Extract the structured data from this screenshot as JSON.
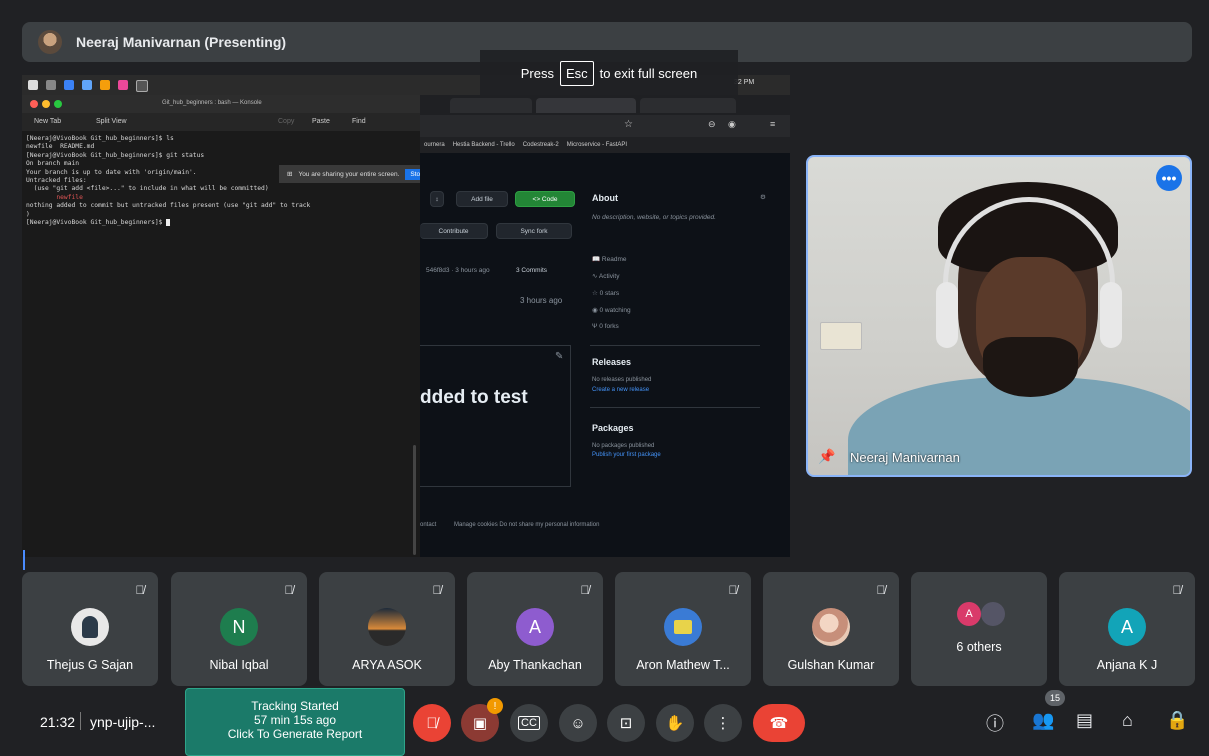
{
  "presenter_bar": {
    "title": "Neeraj Manivarnan (Presenting)"
  },
  "fullscreen_hint": {
    "before": "Press",
    "key": "Esc",
    "after": "to exit full screen"
  },
  "mac": {
    "clock": "32 PM"
  },
  "terminal": {
    "title": "Git_hub_beginners : bash — Konsole",
    "toolbar": {
      "new_tab": "New Tab",
      "split_view": "Split View",
      "copy": "Copy",
      "paste": "Paste",
      "find": "Find"
    },
    "lines": [
      "[Neeraj@VivoBook Git_hub_beginners]$ ls",
      "newfile  README.md",
      "[Neeraj@VivoBook Git_hub_beginners]$ git status",
      "On branch main",
      "Your branch is up to date with 'origin/main'.",
      "",
      "Untracked files:",
      "  (use \"git add <file>...\" to include in what will be committed)"
    ],
    "untracked_file": "        newfile",
    "lines_after": [
      "",
      "nothing added to commit but untracked files present (use \"git add\" to track",
      ")",
      "[Neeraj@VivoBook Git_hub_beginners]$ "
    ]
  },
  "share_notice": {
    "text": "You are sharing your entire screen.",
    "stop": "Stop Sharing"
  },
  "browser": {
    "bookmarks": [
      "Hestia Backend - Trello",
      "Codestreak-2",
      "Microservice - FastAPI"
    ],
    "bookmark_folder": "ournera",
    "add_file": "Add file",
    "code": "<> Code",
    "contribute": "Contribute",
    "sync_fork": "Sync fork",
    "commit_meta": "546f8d3 · 3 hours ago",
    "commits": "3 Commits",
    "ago": "3 hours ago",
    "big_text": "dded to test",
    "footer": "Manage cookies   Do not share my personal information",
    "footer_left": "ontact",
    "about": {
      "heading": "About",
      "desc": "No description, website, or topics provided.",
      "items": [
        "Readme",
        "Activity",
        "0 stars",
        "0 watching",
        "0 forks"
      ]
    },
    "releases": {
      "heading": "Releases",
      "none": "No releases published",
      "link": "Create a new release"
    },
    "packages": {
      "heading": "Packages",
      "none": "No packages published",
      "link": "Publish your first package"
    }
  },
  "presenter_video": {
    "name": "Neeraj Manivarnan"
  },
  "participants": [
    {
      "name": "Thejus G Sajan",
      "initial": "",
      "color": "#e8e8e8"
    },
    {
      "name": "Nibal Iqbal",
      "initial": "N",
      "color": "#1e7d4e"
    },
    {
      "name": "ARYA ASOK",
      "initial": "",
      "color": "#4a6a8a"
    },
    {
      "name": "Aby Thankachan",
      "initial": "A",
      "color": "#8e5ccf"
    },
    {
      "name": "Aron Mathew T...",
      "initial": "",
      "color": "#3a7bd5"
    },
    {
      "name": "Gulshan Kumar",
      "initial": "",
      "color": "#d4b5a0"
    },
    {
      "name": "6 others",
      "initial": "A",
      "color": "#d93a6a"
    },
    {
      "name": "Anjana K J",
      "initial": "A",
      "color": "#12a4b8"
    }
  ],
  "bottom": {
    "time": "21:32",
    "meeting_code": "ynp-ujip-...",
    "tracking": {
      "line1": "Tracking Started",
      "line2": "57 min 15s ago",
      "line3": "Click To Generate Report"
    },
    "people_count": "15",
    "controls": [
      "mic-off",
      "camera-off",
      "captions",
      "emoji",
      "present",
      "raise-hand",
      "more",
      "leave"
    ],
    "right_icons": [
      "info",
      "people",
      "chat",
      "activities",
      "host-controls"
    ]
  }
}
